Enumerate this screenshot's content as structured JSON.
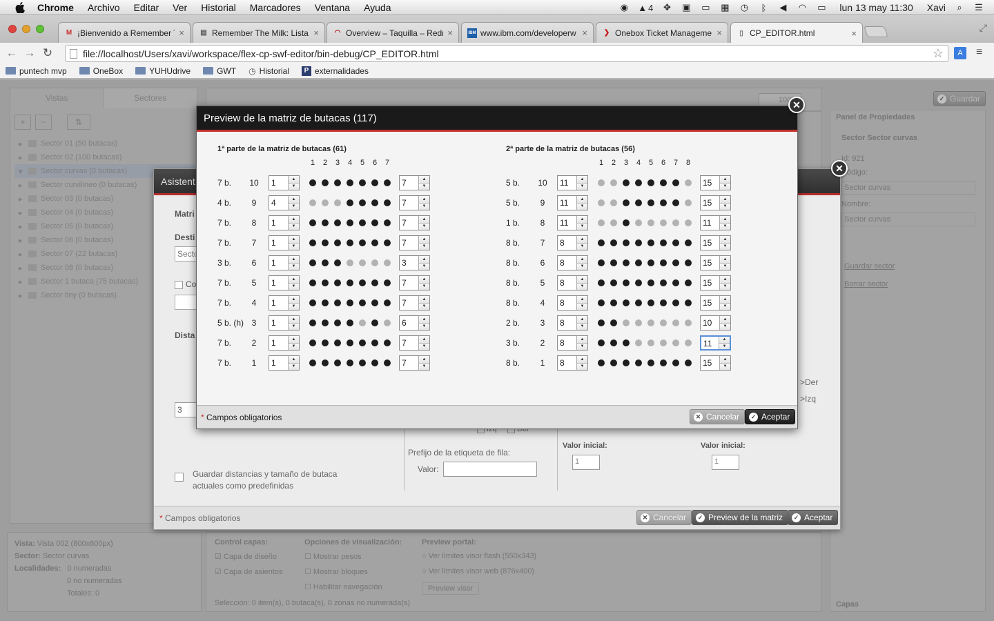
{
  "menubar": {
    "app_name": "Chrome",
    "items": [
      "Archivo",
      "Editar",
      "Ver",
      "Historial",
      "Marcadores",
      "Ventana",
      "Ayuda"
    ],
    "status_badge": "4",
    "clock": "lun 13 may  11:30",
    "user": "Xavi"
  },
  "tabs": [
    {
      "title": "¡Bienvenido a Remember T",
      "icon": "gmail-icon",
      "color": "#c8302c"
    },
    {
      "title": "Remember The Milk: Lista",
      "icon": "printer-icon",
      "color": "#555555"
    },
    {
      "title": "Overview – Taquilla – Redr",
      "icon": "redmine-icon",
      "color": "#b01818"
    },
    {
      "title": "www.ibm.com/developerw",
      "icon": "ibm-icon",
      "color": "#1f5fa8"
    },
    {
      "title": "Onebox Ticket Manageme",
      "icon": "onebox-icon",
      "color": "#c81818"
    },
    {
      "title": "CP_EDITOR.html",
      "icon": "page-icon",
      "color": "#777777"
    }
  ],
  "address": {
    "url": "file://localhost/Users/xavi/workspace/flex-cp-swf-editor/bin-debug/CP_EDITOR.html"
  },
  "bookmarks": [
    "puntech mvp",
    "OneBox",
    "YUHUdrive",
    "GWT",
    "Historial",
    "externalidades"
  ],
  "background": {
    "left_tabs": [
      "Vistas",
      "Sectores"
    ],
    "sectors": [
      "Sector 01 (50 butacas)",
      "Sector 02 (100 butacas)",
      "Sector curvas (0 butacas)",
      "Sector curvilineo (0 butacas)",
      "Sector 03 (0 butacas)",
      "Sector 04 (0 butacas)",
      "Sector 05 (0 butacas)",
      "Sector 06 (0 butacas)",
      "Sector 07 (22 butacas)",
      "Sector 08 (0 butacas)",
      "Sector 1 butaca (75 butacas)",
      "Sector tiny (0 butacas)"
    ],
    "zoom": "100%",
    "save_label": "Guardar",
    "props": {
      "title": "Panel de Propiedades",
      "sector_title": "Sector Sector curvas",
      "id_line": "Id:  921",
      "code_label": "Código:",
      "code_value": "Sector curvas",
      "name_label": "Nombre:",
      "name_value": "Sector curvas",
      "save_sector": "Guardar sector",
      "delete_sector": "Borrar sector",
      "capas": "Capas"
    },
    "info": {
      "vista_label": "Vista:",
      "vista_value": "Vista 002 (800x600px)",
      "sector_label": "Sector:",
      "sector_value": "Sector curvas",
      "loc_label": "Localidades:",
      "loc_num": "0 numeradas",
      "loc_no": "0 no numeradas",
      "loc_total": "Totales: 0"
    },
    "control_capas": {
      "title": "Control capas:",
      "a": "Capa de diseño",
      "b": "Capa de asientos"
    },
    "visual": {
      "title": "Opciones de visualización:",
      "a": "Mostrar pesos",
      "b": "Mostrar bloques",
      "c": "Habilitar navegación"
    },
    "portal": {
      "title": "Preview portal:",
      "a": "Ver límites visor flash (550x343)",
      "b": "Ver límites visor web (876x400)",
      "btn": "Preview visor"
    },
    "selection": "Selección: 0 item(s), 0 butaca(s), 0 zonas no numerada(s)"
  },
  "wizard": {
    "title": "Asistent",
    "matri": "Matri",
    "dest": "Desti",
    "sect_input": "Secto",
    "co": "Co",
    "dist": "Dista",
    "spin_val": "3",
    "der": ">Der",
    "izq": ">Izq",
    "izq_chk": "Izq",
    "der_chk": "Der",
    "valor_inicial_1": "Valor inicial:",
    "valor_inicial_1_val": "1",
    "valor_inicial_2": "Valor inicial:",
    "valor_inicial_2_val": "1",
    "prefijo": "Prefijo de la etiqueta de fila:",
    "valor": "Valor:",
    "guardar_dist": "Guardar distancias y tamaño de butaca",
    "guardar_dist2": "actuales como predefinidas",
    "required": "Campos obligatorios",
    "cancel": "Cancelar",
    "preview": "Preview de la matriz",
    "accept": "Aceptar"
  },
  "preview": {
    "title": "Preview de la matriz de butacas (117)",
    "required": "Campos obligatorios",
    "cancel": "Cancelar",
    "accept": "Aceptar",
    "part1": {
      "title": "1ª parte de la matriz de butacas (61)",
      "columns": [
        "1",
        "2",
        "3",
        "4",
        "5",
        "6",
        "7"
      ],
      "rows": [
        {
          "label": "7 b.",
          "num": "10",
          "start": "1",
          "end": "7",
          "seats": [
            1,
            1,
            1,
            1,
            1,
            1,
            1
          ]
        },
        {
          "label": "4 b.",
          "num": "9",
          "start": "4",
          "end": "7",
          "seats": [
            0,
            0,
            0,
            1,
            1,
            1,
            1
          ]
        },
        {
          "label": "7 b.",
          "num": "8",
          "start": "1",
          "end": "7",
          "seats": [
            1,
            1,
            1,
            1,
            1,
            1,
            1
          ]
        },
        {
          "label": "7 b.",
          "num": "7",
          "start": "1",
          "end": "7",
          "seats": [
            1,
            1,
            1,
            1,
            1,
            1,
            1
          ]
        },
        {
          "label": "3 b.",
          "num": "6",
          "start": "1",
          "end": "3",
          "seats": [
            1,
            1,
            1,
            0,
            0,
            0,
            0
          ]
        },
        {
          "label": "7 b.",
          "num": "5",
          "start": "1",
          "end": "7",
          "seats": [
            1,
            1,
            1,
            1,
            1,
            1,
            1
          ]
        },
        {
          "label": "7 b.",
          "num": "4",
          "start": "1",
          "end": "7",
          "seats": [
            1,
            1,
            1,
            1,
            1,
            1,
            1
          ]
        },
        {
          "label": "5 b. (h)",
          "num": "3",
          "start": "1",
          "end": "6",
          "seats": [
            1,
            1,
            1,
            1,
            0,
            1,
            0
          ]
        },
        {
          "label": "7 b.",
          "num": "2",
          "start": "1",
          "end": "7",
          "seats": [
            1,
            1,
            1,
            1,
            1,
            1,
            1
          ]
        },
        {
          "label": "7 b.",
          "num": "1",
          "start": "1",
          "end": "7",
          "seats": [
            1,
            1,
            1,
            1,
            1,
            1,
            1
          ]
        }
      ]
    },
    "part2": {
      "title": "2ª parte de la matriz de butacas (56)",
      "columns": [
        "1",
        "2",
        "3",
        "4",
        "5",
        "6",
        "7",
        "8"
      ],
      "rows": [
        {
          "label": "5 b.",
          "num": "10",
          "start": "11",
          "end": "15",
          "seats": [
            0,
            0,
            1,
            1,
            1,
            1,
            1,
            0
          ]
        },
        {
          "label": "5 b.",
          "num": "9",
          "start": "11",
          "end": "15",
          "seats": [
            0,
            0,
            1,
            1,
            1,
            1,
            1,
            0
          ]
        },
        {
          "label": "1 b.",
          "num": "8",
          "start": "11",
          "end": "11",
          "seats": [
            0,
            0,
            1,
            0,
            0,
            0,
            0,
            0
          ]
        },
        {
          "label": "8 b.",
          "num": "7",
          "start": "8",
          "end": "15",
          "seats": [
            1,
            1,
            1,
            1,
            1,
            1,
            1,
            1
          ]
        },
        {
          "label": "8 b.",
          "num": "6",
          "start": "8",
          "end": "15",
          "seats": [
            1,
            1,
            1,
            1,
            1,
            1,
            1,
            1
          ]
        },
        {
          "label": "8 b.",
          "num": "5",
          "start": "8",
          "end": "15",
          "seats": [
            1,
            1,
            1,
            1,
            1,
            1,
            1,
            1
          ]
        },
        {
          "label": "8 b.",
          "num": "4",
          "start": "8",
          "end": "15",
          "seats": [
            1,
            1,
            1,
            1,
            1,
            1,
            1,
            1
          ]
        },
        {
          "label": "2 b.",
          "num": "3",
          "start": "8",
          "end": "10",
          "seats": [
            1,
            1,
            0,
            0,
            0,
            0,
            0,
            0
          ]
        },
        {
          "label": "3 b.",
          "num": "2",
          "start": "8",
          "end": "11",
          "seats": [
            1,
            1,
            1,
            0,
            0,
            0,
            0,
            0
          ],
          "focus": true
        },
        {
          "label": "8 b.",
          "num": "1",
          "start": "8",
          "end": "15",
          "seats": [
            1,
            1,
            1,
            1,
            1,
            1,
            1,
            1
          ]
        }
      ]
    }
  }
}
